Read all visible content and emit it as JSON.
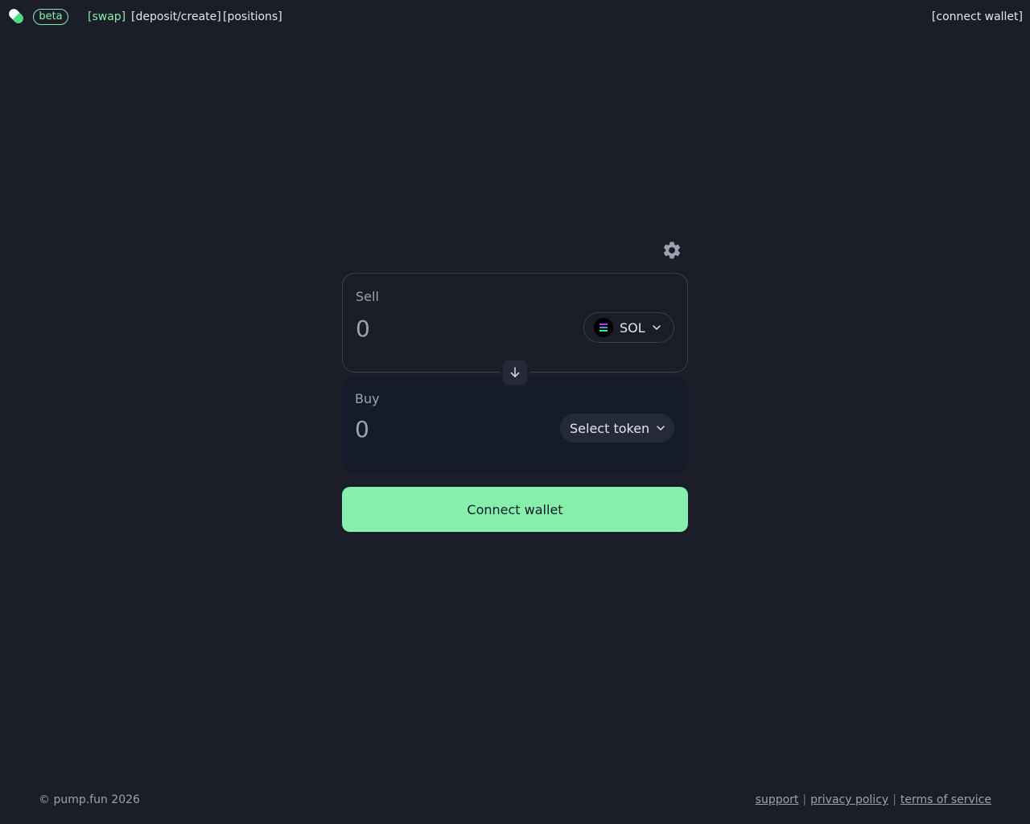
{
  "header": {
    "logo_icon": "pill-icon",
    "badge": "beta",
    "nav": [
      {
        "label": "[swap]",
        "active": true
      },
      {
        "label": "[deposit/create]",
        "active": false
      },
      {
        "label": "[positions]",
        "active": false
      }
    ],
    "connect_wallet": "[connect wallet]"
  },
  "swap": {
    "settings_icon": "gear-icon",
    "sell": {
      "label": "Sell",
      "amount_placeholder": "0",
      "token": "SOL",
      "token_icon": "solana-icon"
    },
    "switch_icon": "arrow-down-icon",
    "buy": {
      "label": "Buy",
      "amount_placeholder": "0",
      "token_button": "Select token"
    },
    "connect_button": "Connect wallet"
  },
  "footer": {
    "copyright": "© pump.fun 2026",
    "links": [
      "support",
      "privacy policy",
      "terms of service"
    ],
    "separator": "|"
  },
  "colors": {
    "background": "#1b1d28",
    "accent": "#86efac",
    "buy_panel": "#161b2b"
  }
}
